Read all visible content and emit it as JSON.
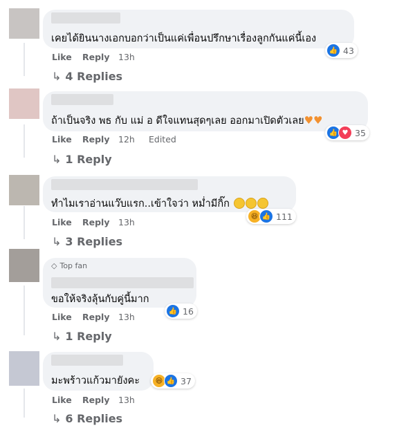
{
  "comments": [
    {
      "text": "เคยได้ยินนางเอกบอกว่าเป็นแค่เพื่อนปรึกษาเรื่องลูกกันแค่นี้เอง",
      "like": "Like",
      "reply": "Reply",
      "time": "13h",
      "reaction_count": "43",
      "replies": "4 Replies",
      "avatar_color": "#c8c4c2"
    },
    {
      "text": "ถ้าเป็นจริง พธ กับ แม่ อ ดีใจแทนสุดๆเลย ออกมาเปิดตัวเลย",
      "like": "Like",
      "reply": "Reply",
      "time": "12h",
      "edited": "Edited",
      "reaction_count": "35",
      "replies": "1 Reply",
      "avatar_color": "#e0c6c4"
    },
    {
      "text": "ทำไมเราอ่านแว๊บแรก..เข้าใจว่า หม่ำมีกิ๊ก",
      "like": "Like",
      "reply": "Reply",
      "time": "13h",
      "reaction_count": "111",
      "replies": "3 Replies",
      "avatar_color": "#bcb7b0"
    },
    {
      "badge": "Top fan",
      "text": "ขอให้จริงลุ้นกับคู่นี้มาก",
      "like": "Like",
      "reply": "Reply",
      "time": "13h",
      "reaction_count": "16",
      "replies": "1 Reply",
      "avatar_color": "#a39e9a"
    },
    {
      "text": "มะพร้าวแก้วมายังคะ",
      "like": "Like",
      "reply": "Reply",
      "time": "13h",
      "reaction_count": "37",
      "replies": "6 Replies",
      "avatar_color": "#c5c8d3"
    }
  ],
  "icons": {
    "reply_arrow": "↳",
    "like": "thumbs-up-icon",
    "love": "heart-icon",
    "haha": "haha-icon",
    "top_fan": "diamond-icon"
  },
  "colors": {
    "bubble": "#f0f2f5",
    "like_blue": "#1b74e4",
    "love_red": "#f33e58",
    "haha_yellow": "#f7b125",
    "meta_gray": "#65676b"
  }
}
